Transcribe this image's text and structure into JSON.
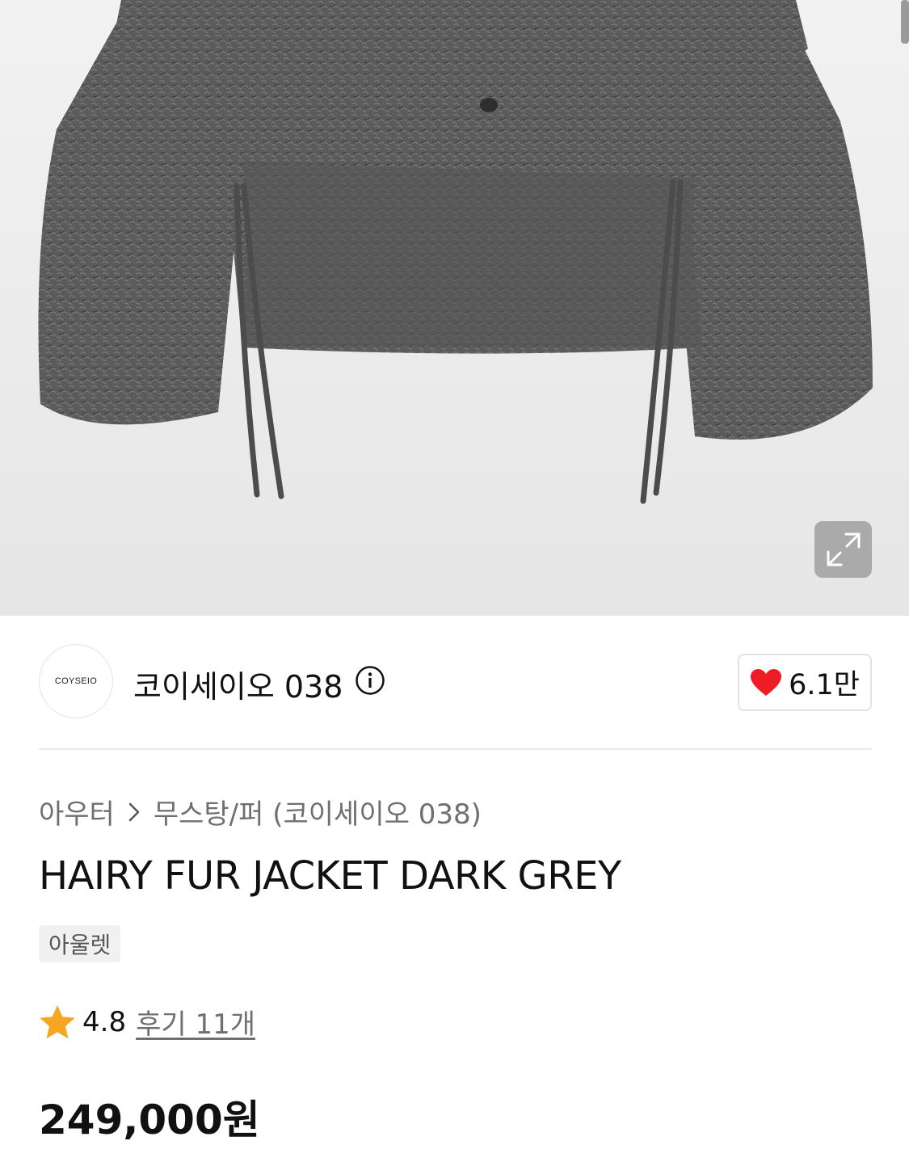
{
  "brand": {
    "logo_text": "COYSEIO",
    "name": "코이세이오 038",
    "likes": "6.1만"
  },
  "breadcrumb": {
    "category": "아우터",
    "subcategory": "무스탕/퍼 (코이세이오 038)"
  },
  "product": {
    "title": "HAIRY FUR JACKET DARK GREY",
    "badge": "아울렛",
    "rating": "4.8",
    "review_link": "후기 11개",
    "price": "249,000원"
  },
  "icons": {
    "expand": "expand-icon",
    "info": "info-icon",
    "heart": "heart-icon",
    "star": "star-icon",
    "chevron": "chevron-right-icon"
  },
  "colors": {
    "heart": "#ee1c25",
    "star": "#f5a623",
    "jacket": "#5a5a5a"
  }
}
